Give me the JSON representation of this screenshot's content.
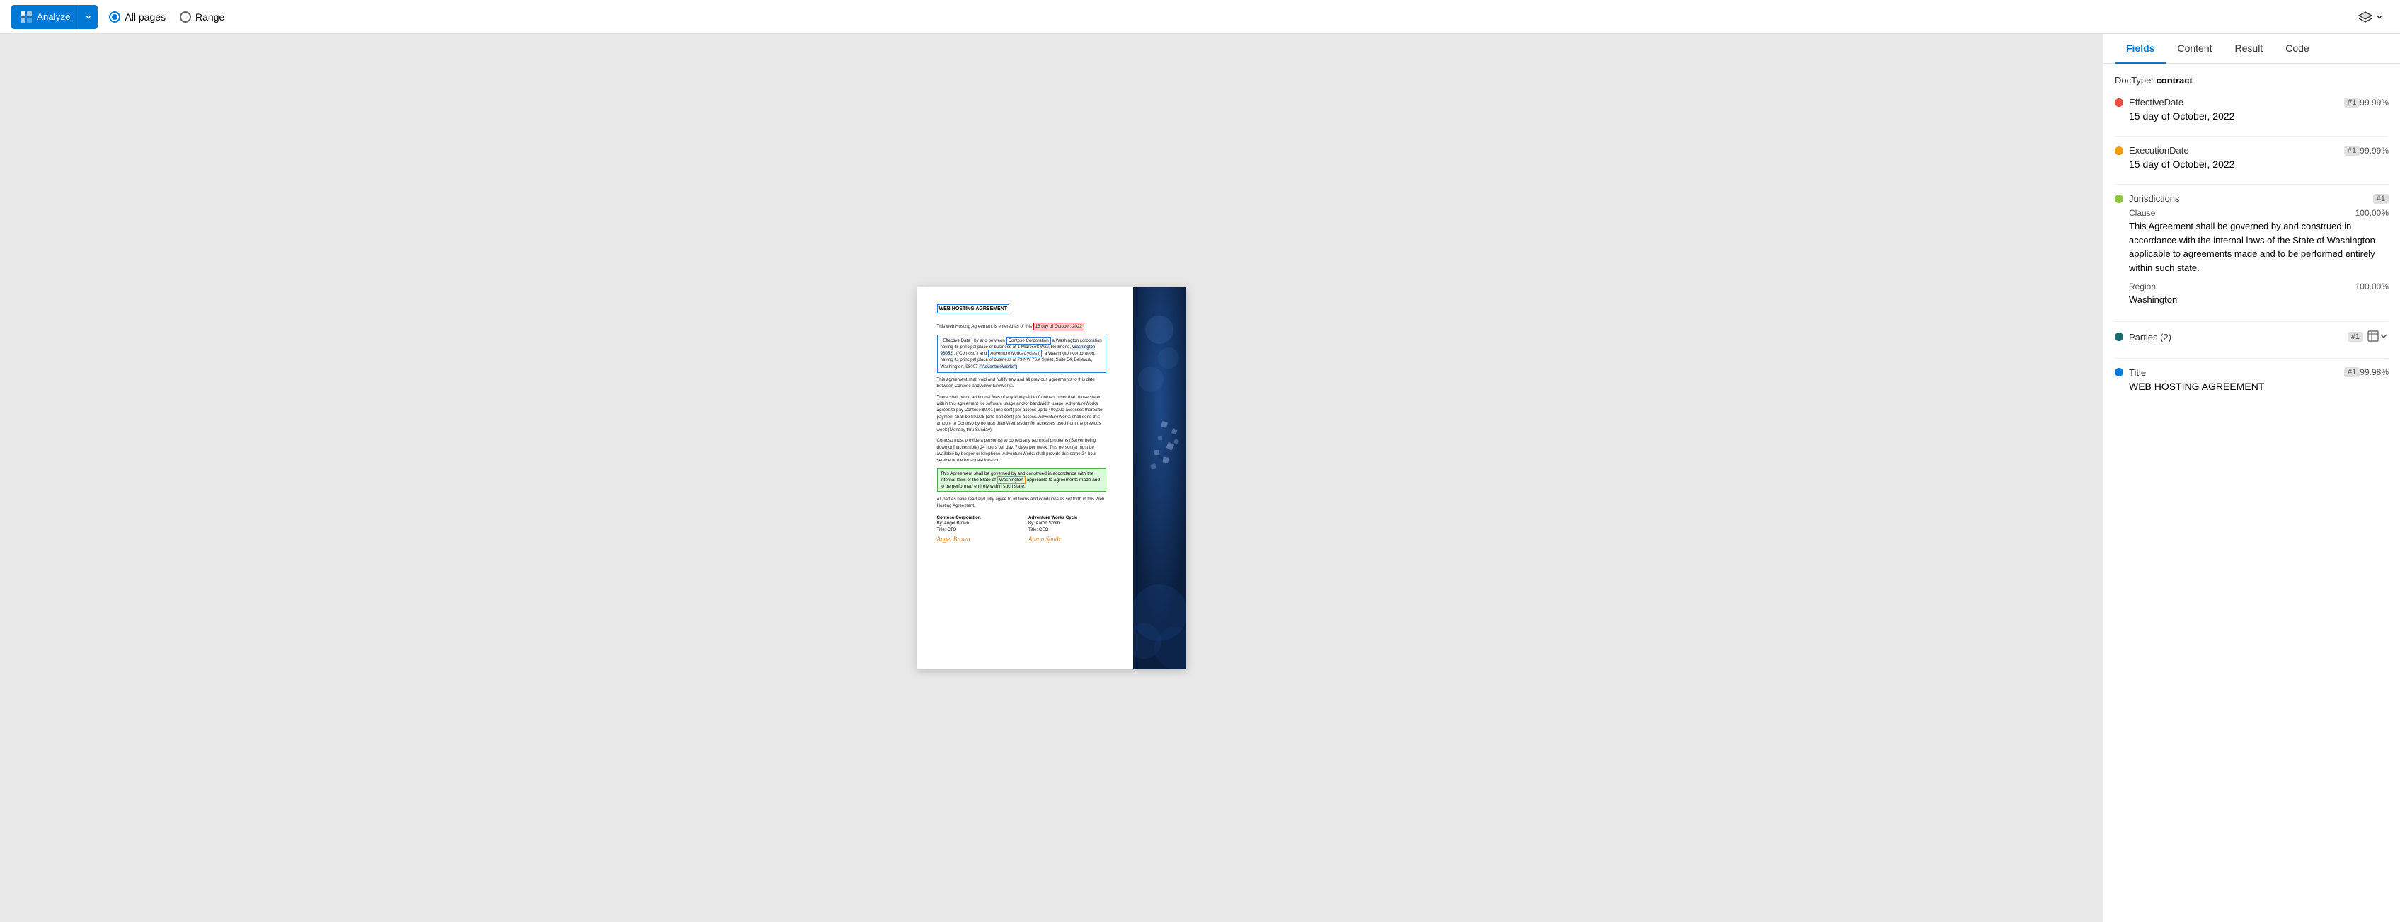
{
  "toolbar": {
    "analyze_label": "Analyze",
    "all_pages_label": "All pages",
    "range_label": "Range",
    "layers_icon": "⊞"
  },
  "document": {
    "title": "WEB HOSTING AGREEMENT",
    "intro": "This web Hosting Agreement is entered as of this",
    "effective_date_highlight": "15 day of October, 2022",
    "party1_block": "Effective Date ) by and between Contoso Corporation a Washington corporation having its principal place of business at 1 Microsoft Way, Redmond, Washington 98052 (\"Contoso\") and AdventureWorks Cycles (\"AdventureWorks\"), a Washington corporation, having its principal place of business at 79 NW 76st Street, Suite 54, Bellevue, Washington 98007 (\"AdventureWorks\").",
    "section1": "This agreement shall void and nullify any and all previous agreements to this date between Contoso and AdventureWorks.",
    "section2": "There shall be no additional fees of any kind paid to Contoso, other than those stated within this agreement for software usage and/or bandwidth usage. AdventureWorks agrees to pay Contoso $0.01 (one cent) per access up to 400,000 accesses thereafter payment shall be $0.005 (one-half cent) per access. AdventureWorks shall send this amount to Contoso by no later than Wednesday for accesses used from the previous week (Monday thru Sunday).",
    "section3": "Contoso must provide a person(s) to correct any technical problems (Server being down or inaccessible) 24 hours per day, 7 days per week. This person(s) must be available by beeper or telephone. AdventureWorks shall provide this same 24 hour service at the broadcast location.",
    "jurisdiction_highlight": "This Agreement shall be governed by and construed in accordance with the internal laws of the State of Washington applicable to agreements made and to be performed entirely within such state.",
    "closing": "All parties have read and fully agree to all terms and conditions as set forth in this Web Hosting Agreement.",
    "party1_name": "Contoso Corporation",
    "party1_by": "By: Angel Brown",
    "party1_title": "Title: CTO",
    "party1_signature": "Angel Brown",
    "party2_name": "Adventure Works Cycle",
    "party2_by": "By: Aaron Smith",
    "party2_title": "Title: CEO",
    "party2_signature": "Aaron Smith"
  },
  "panel": {
    "tabs": [
      "Fields",
      "Content",
      "Result",
      "Code"
    ],
    "active_tab": "Fields",
    "doctype_label": "DocType:",
    "doctype_value": "contract",
    "fields": [
      {
        "name": "EffectiveDate",
        "badge": "#1",
        "dot_color": "#e74c3c",
        "confidence": "99.99%",
        "value": "15 day of October, 2022",
        "subfields": []
      },
      {
        "name": "ExecutionDate",
        "badge": "#1",
        "dot_color": "#f39c12",
        "confidence": "99.99%",
        "value": "15 day of October, 2022",
        "subfields": []
      },
      {
        "name": "Jurisdictions",
        "badge": "#1",
        "dot_color": "#8dc63f",
        "confidence": "",
        "value": "",
        "subfields": [
          {
            "label": "Clause",
            "confidence": "100.00%",
            "value": "This Agreement shall be governed by and construed in accordance with the internal laws of the State of Washington applicable to agreements made and to be performed entirely within such state."
          },
          {
            "label": "Region",
            "confidence": "100.00%",
            "value": "Washington"
          }
        ]
      },
      {
        "name": "Parties",
        "badge": "#1",
        "count": "(2)",
        "dot_color": "#1a6b6b",
        "confidence": "",
        "value": "",
        "has_table": true,
        "expandable": true,
        "subfields": []
      },
      {
        "name": "Title",
        "badge": "#1",
        "dot_color": "#0078d4",
        "confidence": "99.98%",
        "value": "WEB HOSTING AGREEMENT",
        "subfields": []
      }
    ]
  }
}
